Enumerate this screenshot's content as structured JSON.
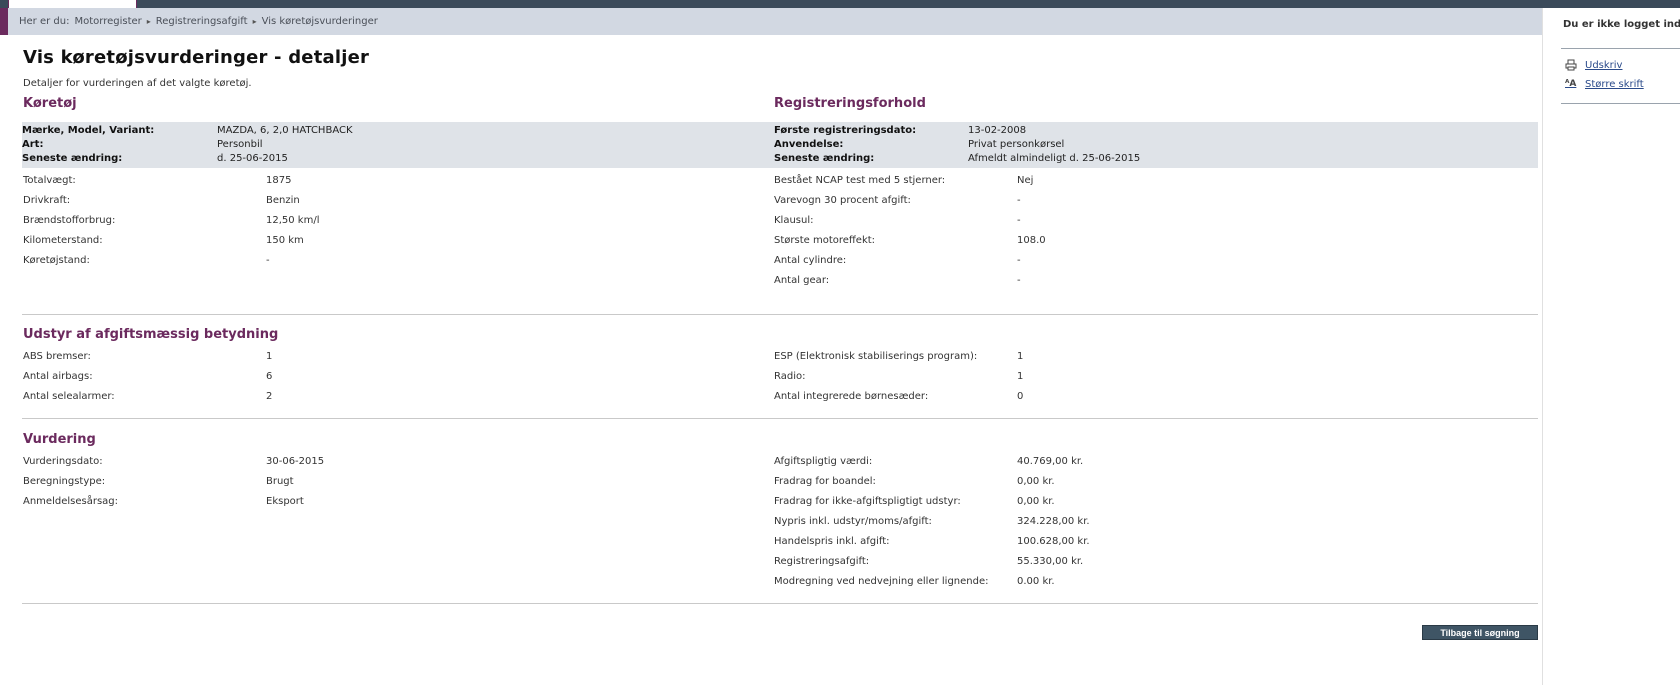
{
  "breadcrumb": {
    "prefix": "Her er du:",
    "items": [
      "Motorregister",
      "Registreringsafgift",
      "Vis køretøjsvurderinger"
    ]
  },
  "page": {
    "title": "Vis køretøjsvurderinger - detaljer",
    "intro": "Detaljer for vurderingen af det valgte køretøj."
  },
  "vehicle": {
    "heading": "Køretøj",
    "make_label": "Mærke, Model, Variant:",
    "make_value": "MAZDA, 6, 2,0 HATCHBACK",
    "type_label": "Art:",
    "type_value": "Personbil",
    "changed_label": "Seneste ændring:",
    "changed_value": "d. 25-06-2015"
  },
  "registration": {
    "heading": "Registreringsforhold",
    "first_label": "Første registreringsdato:",
    "first_value": "13-02-2008",
    "usage_label": "Anvendelse:",
    "usage_value": "Privat personkørsel",
    "changed_label": "Seneste ændring:",
    "changed_value": "Afmeldt almindeligt d. 25-06-2015"
  },
  "details_left": [
    {
      "label": "Totalvægt:",
      "value": "1875"
    },
    {
      "label": "Drivkraft:",
      "value": "Benzin"
    },
    {
      "label": "Brændstofforbrug:",
      "value": "12,50 km/l"
    },
    {
      "label": "Kilometerstand:",
      "value": "150 km"
    },
    {
      "label": "Køretøjstand:",
      "value": "-"
    }
  ],
  "details_right": [
    {
      "label": "Bestået NCAP test med 5 stjerner:",
      "value": "Nej"
    },
    {
      "label": "Varevogn 30 procent afgift:",
      "value": "-"
    },
    {
      "label": "Klausul:",
      "value": "-"
    },
    {
      "label": "Største motoreffekt:",
      "value": "108.0"
    },
    {
      "label": "Antal cylindre:",
      "value": "-"
    },
    {
      "label": "Antal gear:",
      "value": "-"
    }
  ],
  "equipment": {
    "heading": "Udstyr af afgiftsmæssig betydning",
    "left": [
      {
        "label": "ABS bremser:",
        "value": "1"
      },
      {
        "label": "Antal airbags:",
        "value": "6"
      },
      {
        "label": "Antal selealarmer:",
        "value": "2"
      }
    ],
    "right": [
      {
        "label": "ESP (Elektronisk stabiliserings program):",
        "value": "1"
      },
      {
        "label": "Radio:",
        "value": "1"
      },
      {
        "label": "Antal integrerede børnesæder:",
        "value": "0"
      }
    ]
  },
  "valuation": {
    "heading": "Vurdering",
    "left": [
      {
        "label": "Vurderingsdato:",
        "value": "30-06-2015"
      },
      {
        "label": "Beregningstype:",
        "value": "Brugt"
      },
      {
        "label": "Anmeldelsesårsag:",
        "value": "Eksport"
      }
    ],
    "right": [
      {
        "label": "Afgiftspligtig værdi:",
        "value": "40.769,00 kr."
      },
      {
        "label": "Fradrag for boandel:",
        "value": "0,00 kr."
      },
      {
        "label": "Fradrag for ikke-afgiftspligtigt udstyr:",
        "value": "0,00 kr."
      },
      {
        "label": "Nypris inkl. udstyr/moms/afgift:",
        "value": "324.228,00 kr."
      },
      {
        "label": "Handelspris inkl. afgift:",
        "value": "100.628,00 kr."
      },
      {
        "label": "Registreringsafgift:",
        "value": "55.330,00 kr."
      },
      {
        "label": "Modregning ved nedvejning eller lignende:",
        "value": "0.00 kr."
      }
    ]
  },
  "actions": {
    "back_label": "Tilbage til søgning"
  },
  "sidebar": {
    "login_status": "Du er ikke logget ind.",
    "print_label": "Udskriv",
    "font_label": "Større skrift",
    "font_icon_text": "ᴬA"
  },
  "colors": {
    "accent": "#6b2a5e",
    "breadcrumb_bg": "#d2d8e2",
    "block_bg": "#dfe3e8",
    "button_bg": "#3f5565",
    "link": "#2a4a8a"
  }
}
